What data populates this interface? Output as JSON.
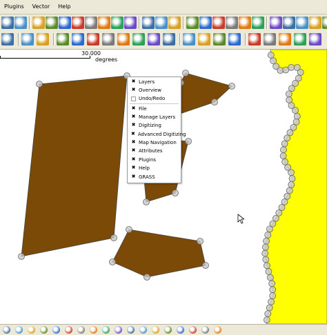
{
  "menubar": {
    "items": [
      "Plugins",
      "Vector",
      "Help"
    ]
  },
  "toolbar1": {
    "icons": [
      "print-icon",
      "zoom-in-tool-icon",
      "zoom-out-tool-icon",
      "layer-table-icon",
      "stack-icon",
      "layers-icon",
      "window-icon",
      "save-icon",
      "composer-icon",
      "grid-icon",
      "page-icon",
      "help-cursor-icon",
      "python-icon",
      "add-raster-icon",
      "add-vector-icon",
      "add-wms-icon",
      "add-postgis-icon",
      "add-layer-icon",
      "remove-layer-icon",
      "green-tool-icon",
      "green-tool2-icon",
      "green-tool3-icon",
      "green-tool4-icon",
      "green-tool5-icon"
    ]
  },
  "toolbar2": {
    "icons": [
      "edit-icon",
      "capture-line-icon",
      "capture-polygon-icon",
      "undo-icon",
      "digitize-icon",
      "node-icon",
      "vertex-add-icon",
      "vertex-move-icon",
      "vertex-delete-icon",
      "pan-icon",
      "cut-icon",
      "copy-icon",
      "paste-icon",
      "delete-icon",
      "refresh-icon",
      "grass-icon",
      "grass2-icon",
      "grass3-icon",
      "grass4-icon",
      "grass5-icon"
    ]
  },
  "scalebar": {
    "value": "30.000",
    "unit": "degrees"
  },
  "context_menu": {
    "items": [
      {
        "label": "Layers",
        "checked": true
      },
      {
        "label": "Overview",
        "checked": true
      },
      {
        "label": "Undo/Redo",
        "checked": false
      },
      {
        "label": "File",
        "checked": true
      },
      {
        "label": "Manage Layers",
        "checked": true
      },
      {
        "label": "Digitizing",
        "checked": true
      },
      {
        "label": "Advanced Digitizing",
        "checked": true
      },
      {
        "label": "Map Navigation",
        "checked": true
      },
      {
        "label": "Attributes",
        "checked": true
      },
      {
        "label": "Plugins",
        "checked": true
      },
      {
        "label": "Help",
        "checked": true
      },
      {
        "label": "GRASS",
        "checked": true
      }
    ],
    "check_mark": "✖"
  },
  "colors": {
    "polygon_fill": "#7a4a06",
    "coast_fill": "#ffff00",
    "vertex": "#c8c8c8",
    "chrome": "#ece9d8"
  }
}
